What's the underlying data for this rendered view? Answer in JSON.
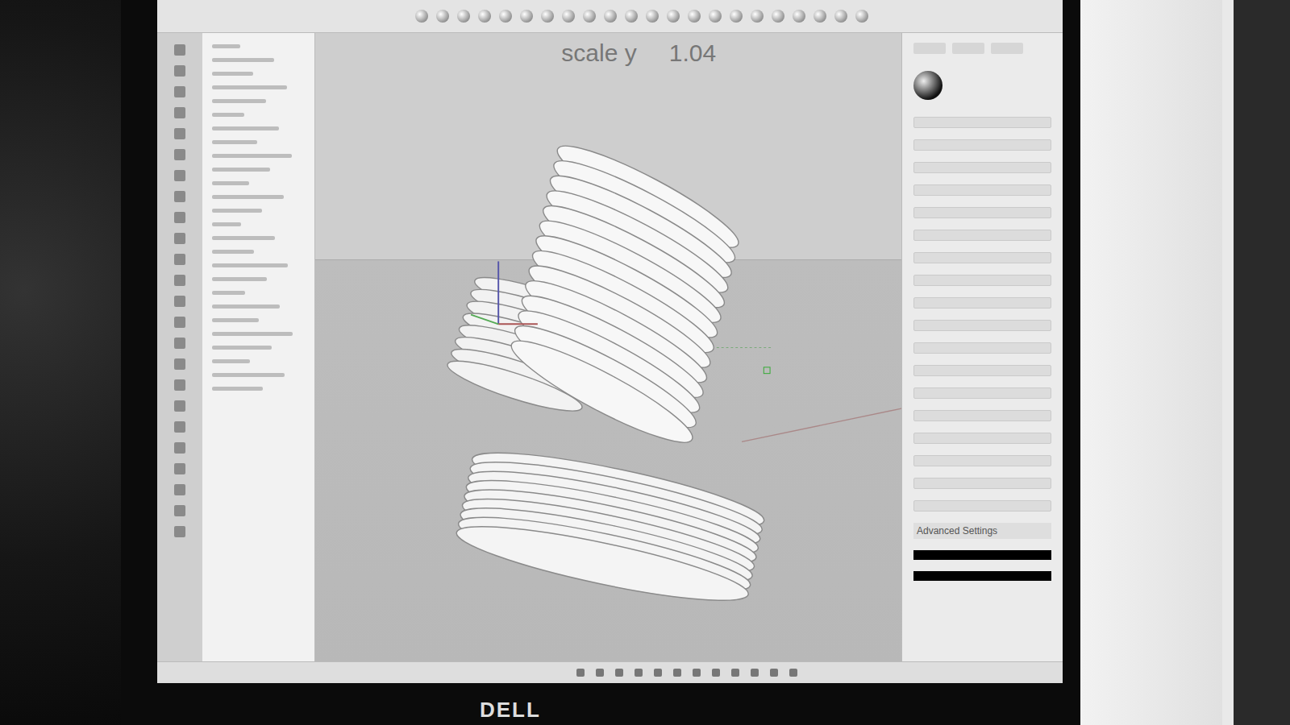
{
  "viewport": {
    "readout": {
      "label": "scale y",
      "value": "1.04"
    }
  },
  "properties": {
    "section": "Advanced Settings"
  },
  "monitor": {
    "brand": "DELL"
  }
}
